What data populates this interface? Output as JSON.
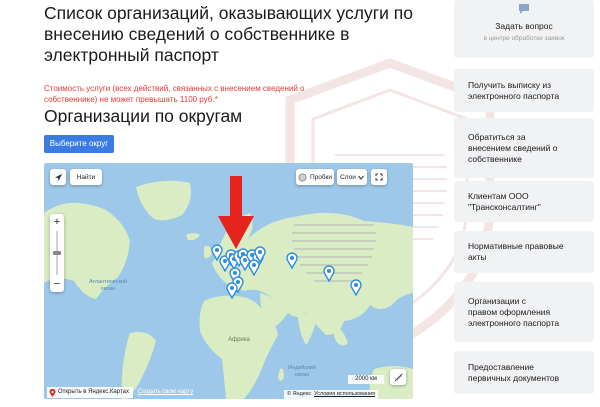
{
  "page": {
    "title_lines": [
      "Список организаций, оказывающих услуги по",
      "внесению сведений о собственнике в",
      "электронный паспорт"
    ],
    "price_note_lines": [
      "Стоимость услуги (всех действий, связанных с внесением сведений о",
      "собственнике) не может превышать 1100 руб.*"
    ],
    "section_title": "Организации по округам",
    "district_button": "Выберите округ"
  },
  "map": {
    "find_label": "Найти",
    "traffic_label": "Пробки",
    "layers_label": "Слои",
    "scale_label": "2000 км",
    "open_in_yandex": "Открыть в Яндекс.Картах",
    "create_map": "Создать свою карту",
    "attribution": "© Яндекс",
    "terms": "Условия использования",
    "labels": {
      "atlantic": [
        "Атлантический",
        "океан"
      ],
      "africa": "Африка",
      "indian": [
        "Индийский",
        "океан"
      ]
    },
    "water_color": "#9ec8ea",
    "land_color": "#d9ecc4",
    "pin_color": "#2d8ce0",
    "arrow_color": "#e52420",
    "marker_count": 17
  },
  "sidebar": {
    "ask": {
      "title": "Задать вопрос",
      "subtitle": "в центре обработки заявок",
      "icon": "chat-bubble-icon"
    },
    "links": [
      [
        "Получить выписку из",
        "электронного паспорта"
      ],
      [
        "Обратиться за",
        "внесением сведений о",
        "собственнике"
      ],
      [
        "Клиентам ООО",
        "\"Трансконсалтинг\""
      ],
      [
        "Нормативные правовые",
        "акты"
      ],
      [
        "Организации с",
        "правом оформления",
        "электронного паспорта"
      ],
      [
        "Предоставление",
        "первичных документов"
      ]
    ]
  }
}
